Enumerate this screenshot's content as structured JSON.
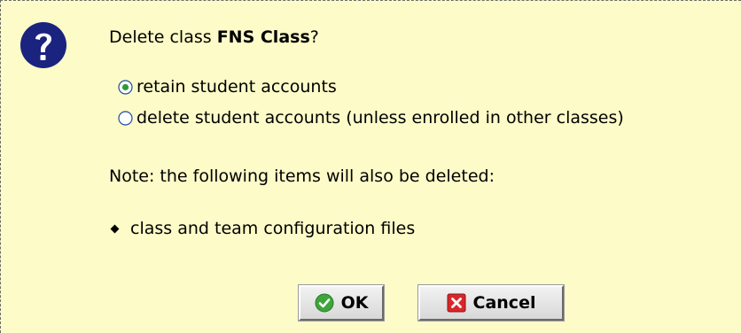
{
  "dialog": {
    "prompt_prefix": "Delete class ",
    "class_name": "FNS Class",
    "prompt_suffix": "?",
    "options": [
      {
        "label": "retain student accounts",
        "selected": true
      },
      {
        "label": "delete student accounts (unless enrolled in other classes)",
        "selected": false
      }
    ],
    "note": "Note: the following items will also be deleted:",
    "items": [
      "class and team configuration files"
    ],
    "ok_label": "OK",
    "cancel_label": "Cancel"
  },
  "colors": {
    "background": "#fdfbc8",
    "question_icon": "#1a237e",
    "ok_icon": "#3fa53b",
    "cancel_icon": "#d9262a"
  },
  "icons": {
    "question": "question-mark-icon",
    "ok": "checkmark-icon",
    "cancel": "x-icon"
  }
}
